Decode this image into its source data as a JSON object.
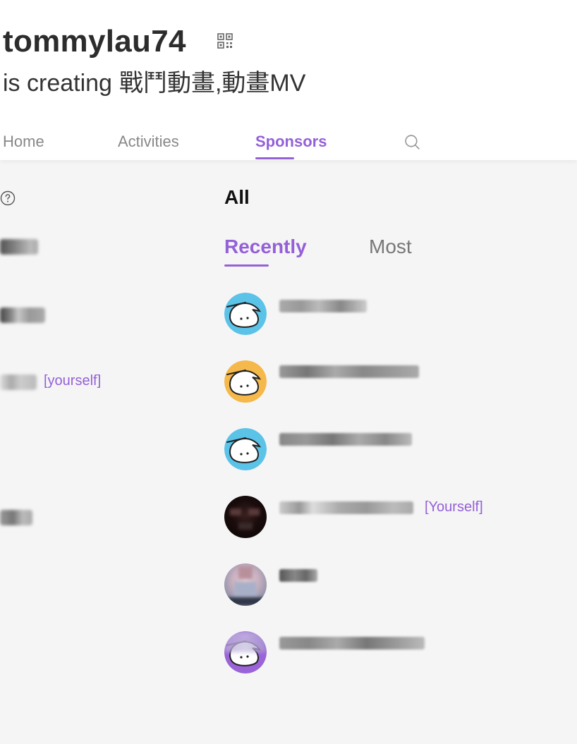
{
  "header": {
    "username": "tommylau74",
    "subtitle_prefix": "is creating",
    "subtitle_topic": "戰鬥動畫,動畫MV"
  },
  "tabs": [
    {
      "label": "Home",
      "active": false
    },
    {
      "label": "Activities",
      "active": false
    },
    {
      "label": "Sponsors",
      "active": true
    }
  ],
  "left_panel": {
    "yourself_label": "[yourself]"
  },
  "sponsors": {
    "title": "All",
    "subtabs": [
      {
        "label": "Recently",
        "active": true
      },
      {
        "label": "Most",
        "active": false
      }
    ],
    "yourself_label": "[Yourself]",
    "list": [
      {
        "avatar": "default-blue",
        "yourself": false
      },
      {
        "avatar": "default-orange",
        "yourself": false
      },
      {
        "avatar": "default-blue",
        "yourself": false
      },
      {
        "avatar": "photo-dark",
        "yourself": true
      },
      {
        "avatar": "photo-light",
        "yourself": false
      },
      {
        "avatar": "default-purple",
        "yourself": false
      }
    ]
  },
  "colors": {
    "accent": "#9460d8",
    "avatar_blue": "#5bc3e8",
    "avatar_orange": "#f5b84a",
    "avatar_purple": "#9a63d8"
  }
}
